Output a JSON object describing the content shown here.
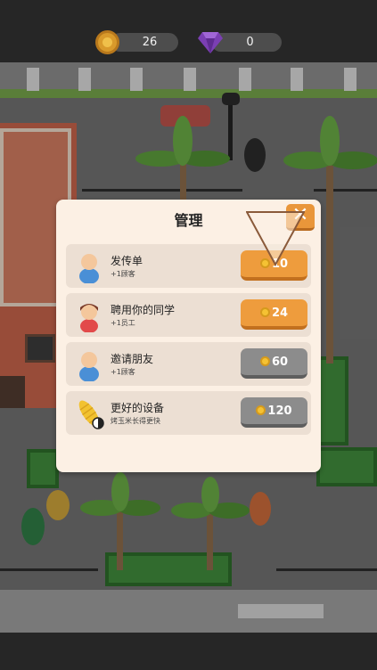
{
  "hud": {
    "coins": "26",
    "gems": "0",
    "coin_icon": "gold-coin-icon",
    "gem_icon": "purple-gem-icon"
  },
  "dialog": {
    "title": "管理",
    "close_icon": "close-x-icon",
    "items": [
      {
        "title": "发传单",
        "subtitle": "+1顾客",
        "price": "10",
        "state": "available",
        "icon": "flyer-person-icon"
      },
      {
        "title": "聘用你的同学",
        "subtitle": "+1员工",
        "price": "24",
        "state": "available",
        "icon": "classmate-icon"
      },
      {
        "title": "邀请朋友",
        "subtitle": "+1顾客",
        "price": "60",
        "state": "locked",
        "icon": "friend-icon"
      },
      {
        "title": "更好的设备",
        "subtitle": "烤玉米长得更快",
        "price": "120",
        "state": "locked",
        "icon": "corn-icon"
      }
    ]
  },
  "colors": {
    "button_available": "#ee9c3d",
    "button_locked": "#8c8c8c",
    "dialog_bg": "#fcf0e4"
  }
}
